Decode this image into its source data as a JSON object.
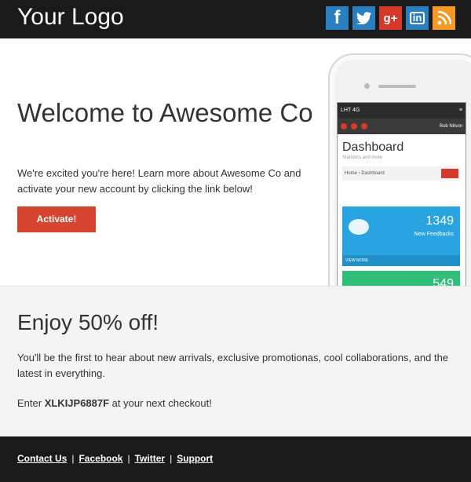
{
  "header": {
    "logo": "Your Logo",
    "social": [
      {
        "name": "facebook-icon",
        "glyph": "f"
      },
      {
        "name": "twitter-icon",
        "glyph": ""
      },
      {
        "name": "google-plus-icon",
        "glyph": "g+"
      },
      {
        "name": "linkedin-icon",
        "glyph": "in"
      },
      {
        "name": "rss-icon",
        "glyph": ""
      }
    ]
  },
  "hero": {
    "title": "Welcome to Awesome Co",
    "text": "We're excited you're here! Learn more about Awesome Co and activate your new account by clicking the link below!",
    "button_label": "Activate!"
  },
  "phone": {
    "status": "LHT 4G",
    "user": "Bob Nilson",
    "dashboard_title": "Dashboard",
    "dashboard_subtitle": "Statistics and more",
    "breadcrumb": "Home › Dashboard",
    "tile1_value": "1349",
    "tile1_label": "New Feedbacks",
    "tile1_more": "VIEW MORE",
    "tile2_value": "549"
  },
  "promo": {
    "title": "Enjoy 50% off!",
    "text": "You'll be the first to hear about new arrivals, exclusive promotionas, cool collaborations, and the latest in everything.",
    "code_prefix": "Enter ",
    "code": "XLKIJP6887F",
    "code_suffix": " at your next checkout!"
  },
  "footer": {
    "links": [
      "Contact Us",
      "Facebook",
      "Twitter",
      "Support"
    ]
  },
  "colors": {
    "header_bg": "#1a1a1a",
    "accent_red": "#d6452f",
    "social_blue": "#2a7fc0",
    "rss_orange": "#f39a25",
    "promo_bg": "#f4f4f4"
  }
}
